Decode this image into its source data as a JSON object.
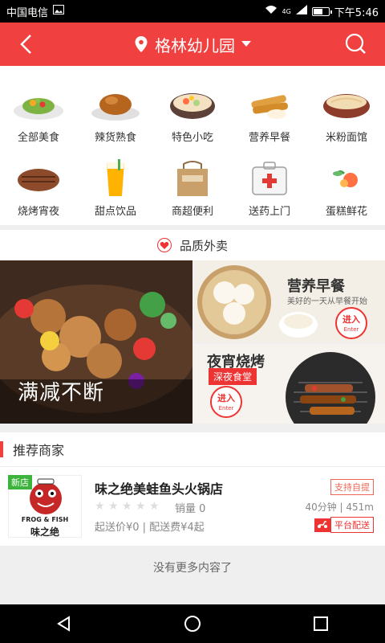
{
  "status_bar": {
    "carrier": "中国电信",
    "network": "4G",
    "time": "下午5:46"
  },
  "header": {
    "location": "格林幼儿园",
    "background": "#f04040"
  },
  "categories": [
    {
      "label": "全部美食",
      "icon": "salad-plate-icon"
    },
    {
      "label": "辣货熟食",
      "icon": "roast-chicken-icon"
    },
    {
      "label": "特色小吃",
      "icon": "snack-bowl-icon"
    },
    {
      "label": "营养早餐",
      "icon": "fried-dough-icon"
    },
    {
      "label": "米粉面馆",
      "icon": "noodle-bowl-icon"
    },
    {
      "label": "烧烤宵夜",
      "icon": "grilled-meat-icon"
    },
    {
      "label": "甜点饮品",
      "icon": "drink-cup-icon"
    },
    {
      "label": "商超便利",
      "icon": "grocery-bag-icon"
    },
    {
      "label": "送药上门",
      "icon": "medicine-box-icon"
    },
    {
      "label": "蛋糕鲜花",
      "icon": "flower-icon"
    }
  ],
  "quality": {
    "title": "品质外卖"
  },
  "banners": {
    "left_caption": "满减不断",
    "breakfast_title": "营养早餐",
    "breakfast_sub": "美好的一天从早餐开始",
    "bbq_title": "夜宵烧烤",
    "bbq_tag": "深夜食堂",
    "enter_label": "进入",
    "enter_sub": "Enter"
  },
  "recommended": {
    "title": "推荐商家"
  },
  "store": {
    "badge": "新店",
    "name": "味之绝美蛙鱼头火锅店",
    "logo_text": "FROG & FISH",
    "logo_brand": "味之绝",
    "rating": 0,
    "sales": "销量 0",
    "fees": "起送价¥0 | 配送费¥4起",
    "pickup": "支持自提",
    "time_distance": "40分钟 | 451m",
    "platform_delivery": "平台配送"
  },
  "footer": {
    "no_more": "没有更多内容了"
  },
  "accent_color": "#f04040"
}
